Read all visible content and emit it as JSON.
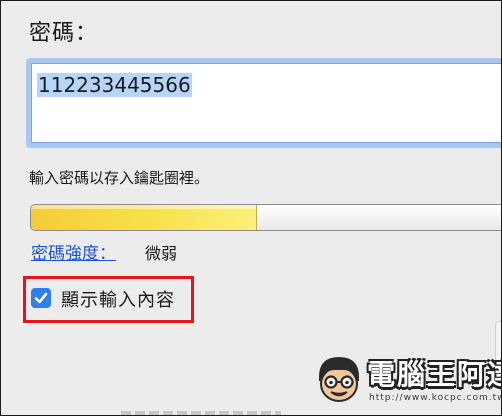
{
  "password": {
    "label": "密碼：",
    "value": "112233445566"
  },
  "hint": "輸入密碼以存入鑰匙圈裡。",
  "strength": {
    "link_label": "密碼強度：",
    "value": "微弱",
    "fill_fraction": 0.47
  },
  "show_contents": {
    "label": "顯示輸入內容",
    "checked": true
  },
  "watermark": {
    "title": "電腦王阿達",
    "url": "http://www.kocpc.com.tw"
  },
  "colors": {
    "accent": "#2f7ef2",
    "link": "#1e50d6",
    "highlight_box": "#e8141c",
    "focus_ring": "#a9c8ef",
    "meter_fill": "#f7e24a"
  }
}
